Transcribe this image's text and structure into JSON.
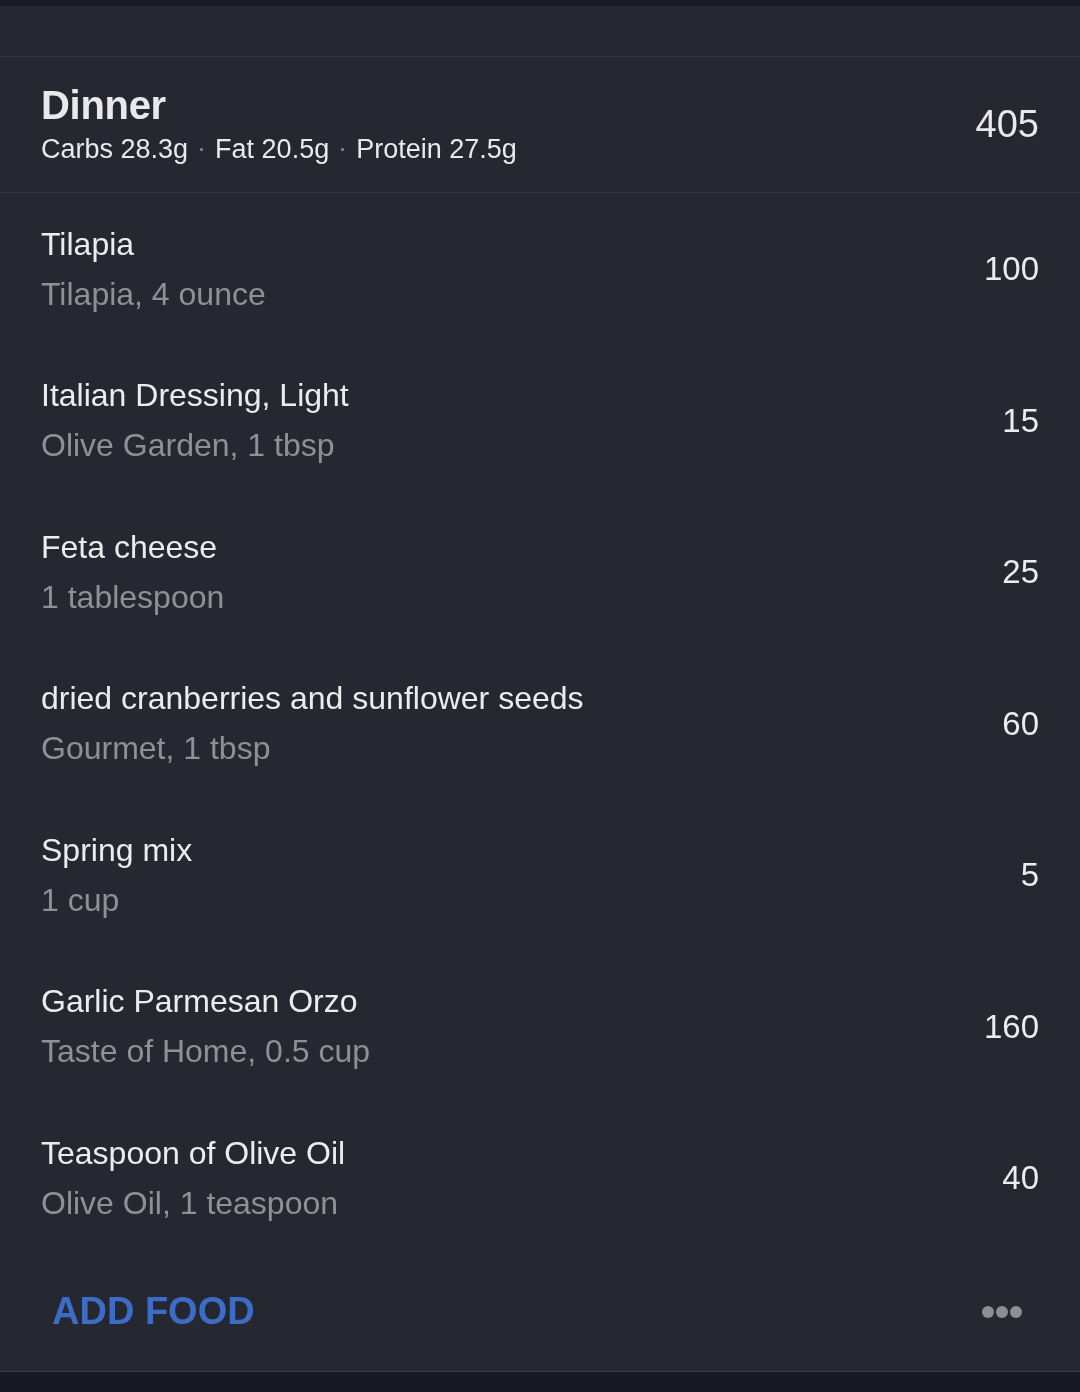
{
  "meal": {
    "title": "Dinner",
    "calories": "405",
    "macros": [
      "Carbs 28.3g",
      "Fat 20.5g",
      "Protein 27.5g"
    ]
  },
  "foods": [
    {
      "name": "Tilapia",
      "detail": "Tilapia, 4 ounce",
      "calories": "100"
    },
    {
      "name": "Italian Dressing, Light",
      "detail": "Olive Garden, 1 tbsp",
      "calories": "15"
    },
    {
      "name": "Feta cheese",
      "detail": "1 tablespoon",
      "calories": "25"
    },
    {
      "name": "dried cranberries and sunflower seeds",
      "detail": "Gourmet, 1 tbsp",
      "calories": "60"
    },
    {
      "name": "Spring mix",
      "detail": "1 cup",
      "calories": "5"
    },
    {
      "name": "Garlic Parmesan Orzo",
      "detail": "Taste of Home, 0.5 cup",
      "calories": "160"
    },
    {
      "name": "Teaspoon of Olive Oil",
      "detail": "Olive Oil, 1 teaspoon",
      "calories": "40"
    }
  ],
  "footer": {
    "add_button": "ADD FOOD"
  }
}
